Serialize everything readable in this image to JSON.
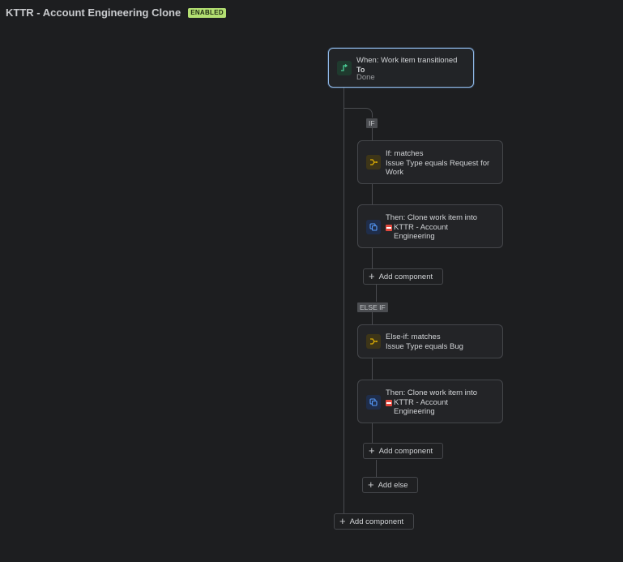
{
  "header": {
    "title": "KTTR - Account Engineering Clone",
    "status": "ENABLED"
  },
  "trigger": {
    "title": "When: Work item transitioned",
    "label": "To",
    "value": "Done",
    "icon": "transition-icon"
  },
  "branch_if": {
    "tag": "IF",
    "condition": {
      "title": "If: matches",
      "detail": "Issue Type equals Request for Work",
      "icon": "branch-icon"
    },
    "action": {
      "title": "Then: Clone work item into",
      "project": "KTTR - Account Engineering",
      "icon": "clone-icon"
    },
    "add_component": "Add component"
  },
  "branch_elseif": {
    "tag": "ELSE IF",
    "condition": {
      "title": "Else-if: matches",
      "detail": "Issue Type equals Bug",
      "icon": "branch-icon"
    },
    "action": {
      "title": "Then: Clone work item into",
      "project": "KTTR - Account Engineering",
      "icon": "clone-icon"
    },
    "add_component": "Add component"
  },
  "add_else": "Add else",
  "add_component_root": "Add component",
  "colors": {
    "accent": "#8fb8e6",
    "badge": "#b3df72",
    "condition": "#e2b203",
    "action": "#579dff",
    "trigger": "#4bce97"
  }
}
